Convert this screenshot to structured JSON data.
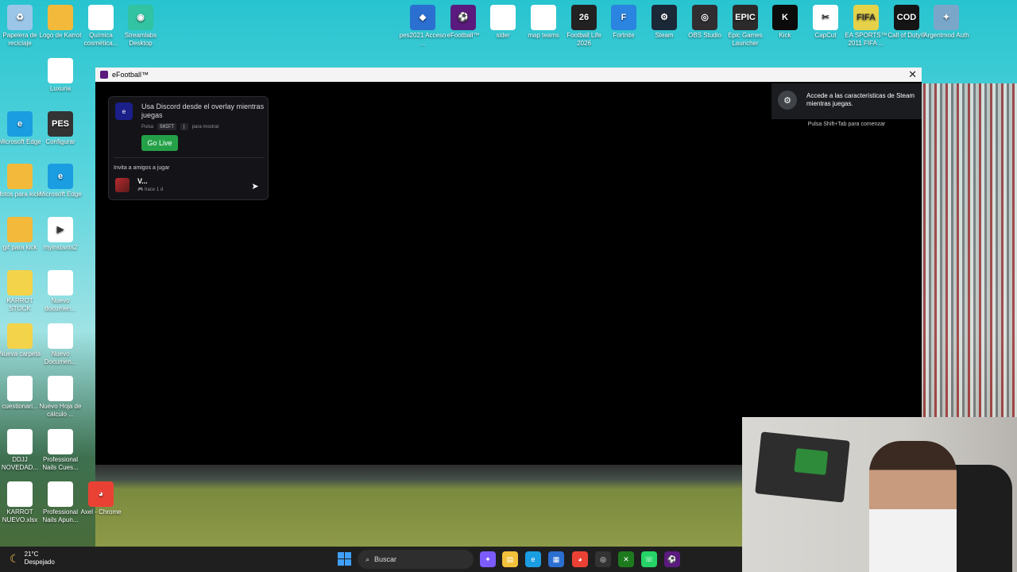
{
  "colors": {
    "accent": "#24a148",
    "window_bg": "#000000",
    "taskbar": "#1f1f1f"
  },
  "desktop": {
    "icons": [
      {
        "label": "Papelera de reciclaje",
        "icon": "recycle-bin-icon",
        "glyph": "♻",
        "color": "#9bc6e8"
      },
      {
        "label": "Logo de Karrot",
        "icon": "folder-icon",
        "glyph": "",
        "color": "#f3b93a"
      },
      {
        "label": "Química cosmética...",
        "icon": "document-icon",
        "glyph": "",
        "color": "#ffffff"
      },
      {
        "label": "Streamlabs Desktop",
        "icon": "streamlabs-icon",
        "glyph": "◉",
        "color": "#31c3a2"
      },
      {
        "label": "pes2021 Acceso ...",
        "icon": "pes-icon",
        "glyph": "◆",
        "color": "#2b6fd1"
      },
      {
        "label": "eFootball™",
        "icon": "efootball-icon",
        "glyph": "⚽",
        "color": "#5b1b7e"
      },
      {
        "label": "sider",
        "icon": "document-icon",
        "glyph": "",
        "color": "#ffffff"
      },
      {
        "label": "map teams",
        "icon": "document-icon",
        "glyph": "",
        "color": "#ffffff"
      },
      {
        "label": "Football Life 2026",
        "icon": "football-life-icon",
        "glyph": "26",
        "color": "#222222"
      },
      {
        "label": "Fortnite",
        "icon": "fortnite-icon",
        "glyph": "F",
        "color": "#2a84e0"
      },
      {
        "label": "Steam",
        "icon": "steam-icon",
        "glyph": "⚙",
        "color": "#1b2838"
      },
      {
        "label": "OBS Studio",
        "icon": "obs-icon",
        "glyph": "◎",
        "color": "#302e31"
      },
      {
        "label": "Epic Games Launcher",
        "icon": "epic-games-icon",
        "glyph": "EPIC",
        "color": "#2b2b2b"
      },
      {
        "label": "Kick",
        "icon": "kick-icon",
        "glyph": "K",
        "color": "#0b0b0b"
      },
      {
        "label": "CapCut",
        "icon": "capcut-icon",
        "glyph": "✂",
        "color": "#ffffff"
      },
      {
        "label": "EA SPORTS™ 2011 FIFA ...",
        "icon": "fifa-icon",
        "glyph": "FIFA",
        "color": "#e6d24a"
      },
      {
        "label": "Call of Duty®",
        "icon": "call-of-duty-icon",
        "glyph": "COD",
        "color": "#151515"
      },
      {
        "label": "Argentmod Auth",
        "icon": "argentmod-icon",
        "glyph": "✦",
        "color": "#7aa7c9"
      },
      {
        "label": "Luxuria",
        "icon": "document-icon",
        "glyph": "",
        "color": "#ffffff"
      },
      {
        "label": "Microsoft Edge",
        "icon": "edge-icon",
        "glyph": "e",
        "color": "#1b9de2"
      },
      {
        "label": "Configurar",
        "icon": "pes-config-icon",
        "glyph": "PES",
        "color": "#333333"
      },
      {
        "label": "fotos para kick",
        "icon": "folder-icon",
        "glyph": "",
        "color": "#f3b93a"
      },
      {
        "label": "Microsoft Edge",
        "icon": "edge-icon",
        "glyph": "e",
        "color": "#1b9de2"
      },
      {
        "label": "gif para kick",
        "icon": "folder-icon",
        "glyph": "",
        "color": "#f3b93a"
      },
      {
        "label": "myinstants2",
        "icon": "media-icon",
        "glyph": "▶",
        "color": "#ffffff"
      },
      {
        "label": "KARROT STOCK",
        "icon": "folder-icon",
        "glyph": "",
        "color": "#f3d34a"
      },
      {
        "label": "Nuevo documen...",
        "icon": "document-icon",
        "glyph": "",
        "color": "#ffffff"
      },
      {
        "label": "Nueva carpeta",
        "icon": "folder-icon",
        "glyph": "",
        "color": "#f3d34a"
      },
      {
        "label": "Nuevo Documen...",
        "icon": "document-icon",
        "glyph": "",
        "color": "#ffffff"
      },
      {
        "label": "cuestionari...",
        "icon": "document-icon",
        "glyph": "",
        "color": "#ffffff"
      },
      {
        "label": "Nuevo Hoja de cálculo ...",
        "icon": "document-icon",
        "glyph": "",
        "color": "#ffffff"
      },
      {
        "label": "DDJJ NOVEDAD...",
        "icon": "document-icon",
        "glyph": "",
        "color": "#ffffff"
      },
      {
        "label": "Professional Nails Cues...",
        "icon": "document-icon",
        "glyph": "",
        "color": "#ffffff"
      },
      {
        "label": "KARROT NUEVO.xlsx",
        "icon": "document-icon",
        "glyph": "",
        "color": "#ffffff"
      },
      {
        "label": "Professional Nails Apun...",
        "icon": "document-icon",
        "glyph": "",
        "color": "#ffffff"
      },
      {
        "label": "Axel - Chrome",
        "icon": "chrome-icon",
        "glyph": "◕",
        "color": "#e94235"
      }
    ]
  },
  "window": {
    "title": "eFootball™"
  },
  "discord": {
    "title": "Usa Discord desde el overlay mientras juegas",
    "hint_prefix": "Pulsa",
    "key1": "SHIFT",
    "key2": "|",
    "hint_suffix": "para mostrar",
    "go_live": "Go Live",
    "invite_label": "Invita a amigos a jugar",
    "friend_name": "V...",
    "friend_status": "🎮 hace 1 d"
  },
  "steam": {
    "notice": "Accede a las características de Steam mientras juegas.",
    "hint": "Pulsa Shift+Tab para comenzar"
  },
  "taskbar": {
    "weather_temp": "21°C",
    "weather_desc": "Despejado",
    "search_placeholder": "Buscar"
  }
}
